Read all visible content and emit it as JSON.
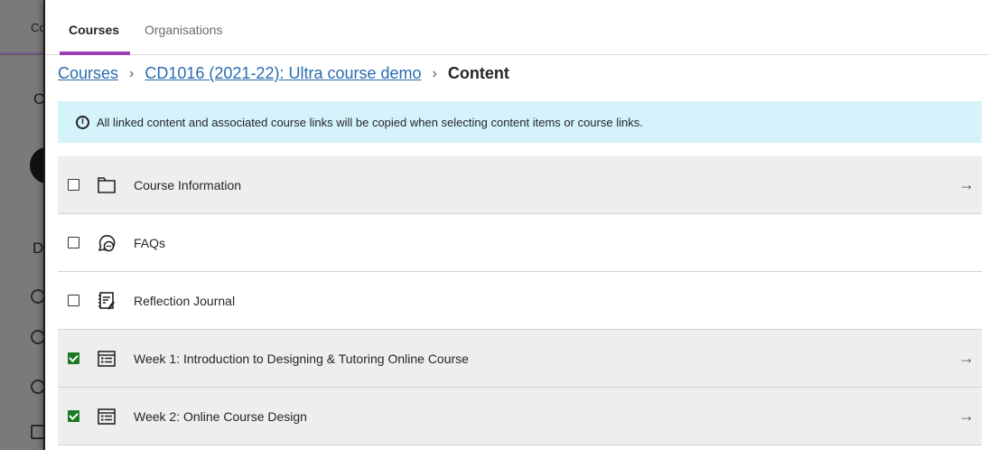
{
  "background": {
    "tab_fragment": "Co",
    "heading_fragment_1": "C",
    "heading_fragment_2": "C",
    "heading_fragment_3": "D"
  },
  "tabs": [
    {
      "label": "Courses",
      "active": true
    },
    {
      "label": "Organisations",
      "active": false
    }
  ],
  "breadcrumb": {
    "root": "Courses",
    "course": "CD1016 (2021-22): Ultra course demo",
    "current": "Content",
    "separator": "›"
  },
  "notice": {
    "icon": "info-icon",
    "text": "All linked content and associated course links will be copied when selecting content items or course links."
  },
  "items": [
    {
      "label": "Course Information",
      "icon": "folder-icon",
      "checked": false,
      "has_arrow": true,
      "shade": "grey"
    },
    {
      "label": "FAQs",
      "icon": "discussion-icon",
      "checked": false,
      "has_arrow": false,
      "shade": "white"
    },
    {
      "label": "Reflection Journal",
      "icon": "journal-icon",
      "checked": false,
      "has_arrow": false,
      "shade": "white"
    },
    {
      "label": "Week 1: Introduction to Designing & Tutoring Online Course",
      "icon": "learning-module-icon",
      "checked": true,
      "has_arrow": true,
      "shade": "grey"
    },
    {
      "label": "Week 2: Online Course Design",
      "icon": "learning-module-icon",
      "checked": true,
      "has_arrow": true,
      "shade": "grey"
    }
  ],
  "arrow_glyph": "→",
  "colors": {
    "accent_tab": "#9b3fb5",
    "link": "#2a6bb0",
    "notice_bg": "#d4f3fb",
    "checked": "#1b7a24"
  }
}
